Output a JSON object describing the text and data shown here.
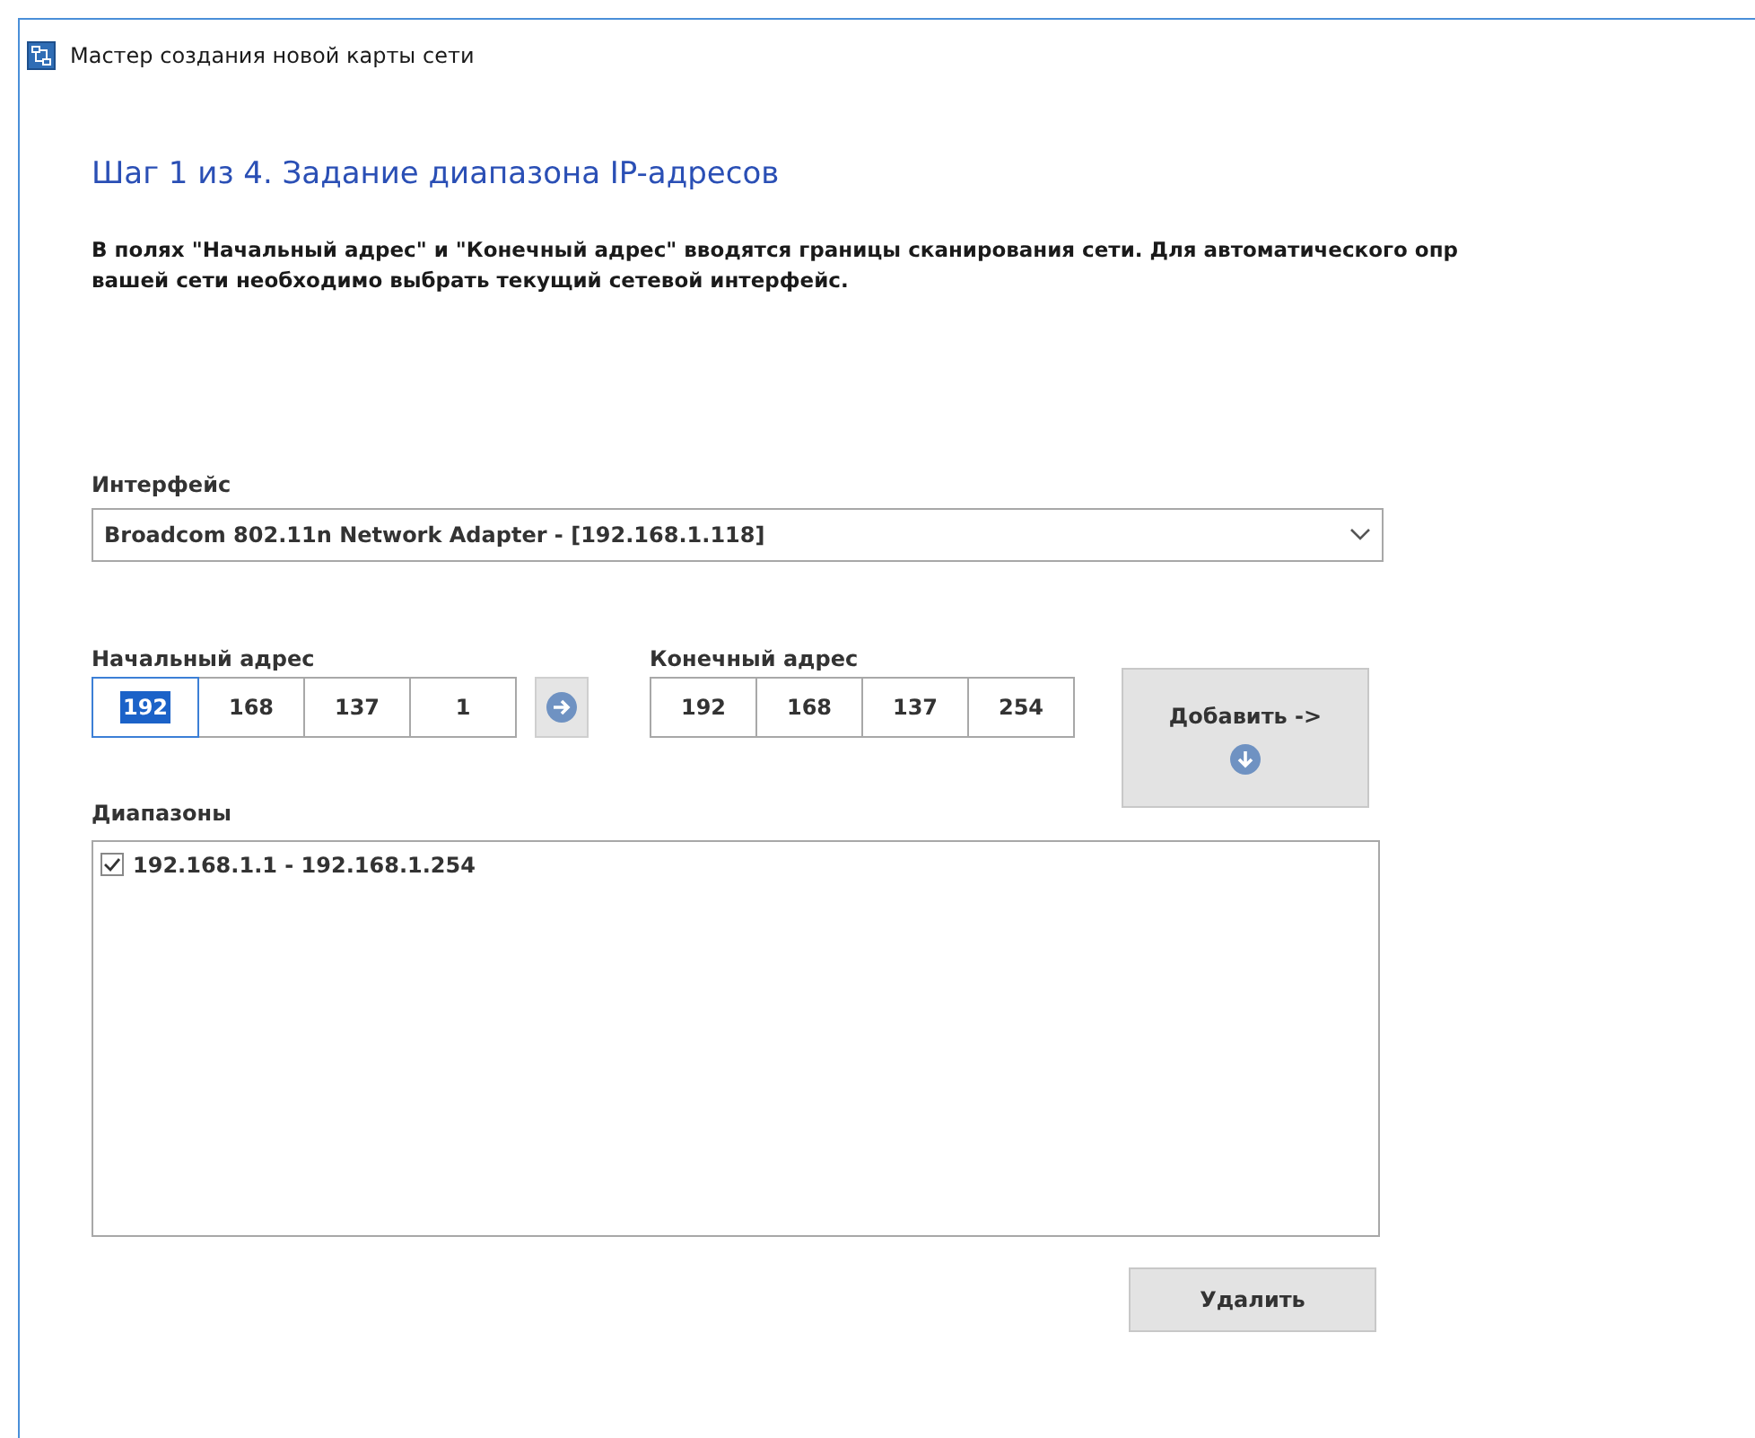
{
  "window": {
    "title": "Мастер создания новой карты сети"
  },
  "heading": "Шаг 1 из 4. Задание диапазона IP-адресов",
  "description": [
    "В полях \"Начальный адрес\" и \"Конечный адрес\" вводятся границы сканирования сети. Для автоматического опр",
    "вашей сети необходимо выбрать текущий сетевой интерфейс."
  ],
  "interface": {
    "label": "Интерфейс",
    "value": "Broadcom 802.11n Network Adapter - [192.168.1.118]"
  },
  "start_address": {
    "label": "Начальный адрес",
    "octets": [
      {
        "value": "192",
        "selected": true
      },
      {
        "value": "168",
        "selected": false
      },
      {
        "value": "137",
        "selected": false
      },
      {
        "value": "1",
        "selected": false
      }
    ]
  },
  "end_address": {
    "label": "Конечный адрес",
    "octets": [
      {
        "value": "192",
        "selected": false
      },
      {
        "value": "168",
        "selected": false
      },
      {
        "value": "137",
        "selected": false
      },
      {
        "value": "254",
        "selected": false
      }
    ]
  },
  "add_button": "Добавить ->",
  "ranges": {
    "label": "Диапазоны",
    "items": [
      {
        "label": "192.168.1.1 - 192.168.1.254",
        "checked": true
      }
    ]
  },
  "delete_button": "Удалить"
}
